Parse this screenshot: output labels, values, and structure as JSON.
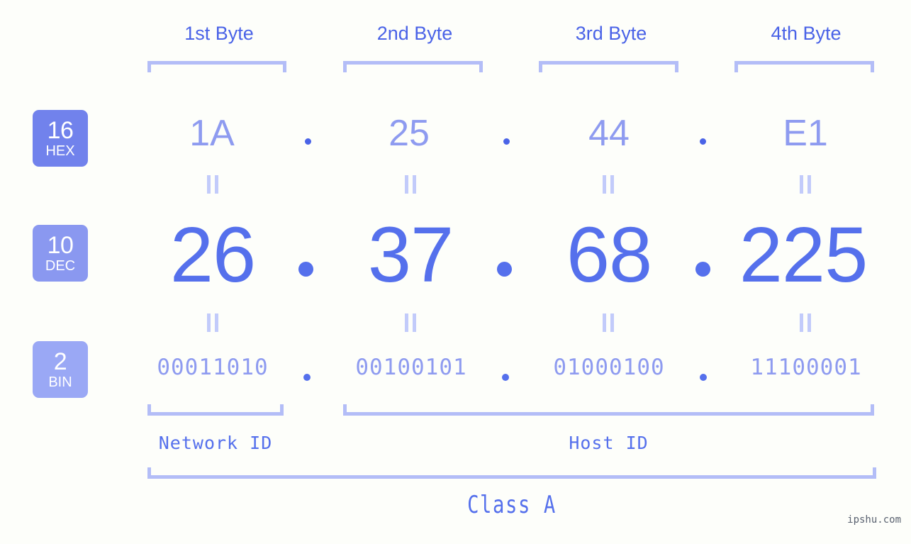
{
  "meta": {
    "background_color": "#fdfefa",
    "accent_strong": "#4a63e7",
    "accent_mid": "#5570ec",
    "accent_light": "#8e9bf0",
    "accent_pale": "#b3bdf7",
    "watermark": "ipshu.com"
  },
  "byte_headers": [
    {
      "label": "1st Byte"
    },
    {
      "label": "2nd Byte"
    },
    {
      "label": "3rd Byte"
    },
    {
      "label": "4th Byte"
    }
  ],
  "bases": [
    {
      "number": "16",
      "name": "HEX",
      "color": "#7182ec"
    },
    {
      "number": "10",
      "name": "DEC",
      "color": "#8a98f0"
    },
    {
      "number": "2",
      "name": "BIN",
      "color": "#9aa8f5"
    }
  ],
  "rows": {
    "hex": {
      "octets": [
        "1A",
        "25",
        "44",
        "E1"
      ],
      "separator": "."
    },
    "dec": {
      "octets": [
        "26",
        "37",
        "68",
        "225"
      ],
      "separator": "."
    },
    "bin": {
      "octets": [
        "00011010",
        "00100101",
        "01000100",
        "11100001"
      ],
      "separator": "."
    }
  },
  "equals_connector": "||",
  "segments": {
    "network_id": "Network ID",
    "host_id": "Host ID"
  },
  "class": {
    "label": "Class A"
  }
}
